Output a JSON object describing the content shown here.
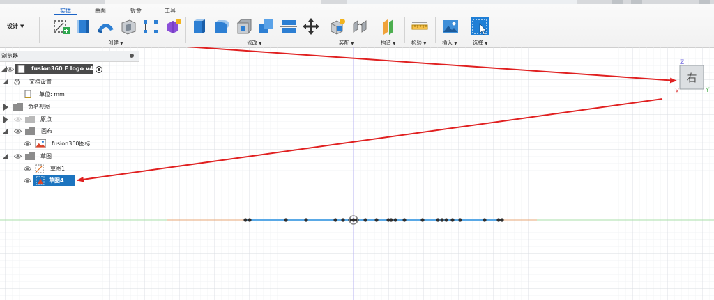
{
  "toolbar": {
    "tabs": [
      "实体",
      "曲面",
      "钣金",
      "工具"
    ],
    "workspace": "设计",
    "groups": {
      "create": "创建",
      "modify": "修改",
      "assemble": "装配",
      "construct": "构造",
      "inspect": "检验",
      "insert": "插入",
      "select": "选择"
    }
  },
  "browser": {
    "title": "浏览器",
    "root": "fusion360 F logo v4",
    "items": {
      "doc_settings": "文档设置",
      "units": "单位: mm",
      "named_views": "命名视图",
      "origin": "原点",
      "canvases": "画布",
      "canvas_image": "fusion360图标",
      "sketches": "草图",
      "sketch1": "草图1",
      "sketch4": "草图4"
    }
  },
  "viewcube": {
    "face": "右",
    "axis_z": "Z",
    "axis_x": "X",
    "axis_y": "Y"
  },
  "colors": {
    "accent": "#1b63c6",
    "selection": "#1c74bf",
    "annotation": "#e02020",
    "sketch_line": "#5aa9e6",
    "axis_x": "#e0a070",
    "axis_y": "#8fd08f",
    "axis_z": "#a8a2f0"
  }
}
